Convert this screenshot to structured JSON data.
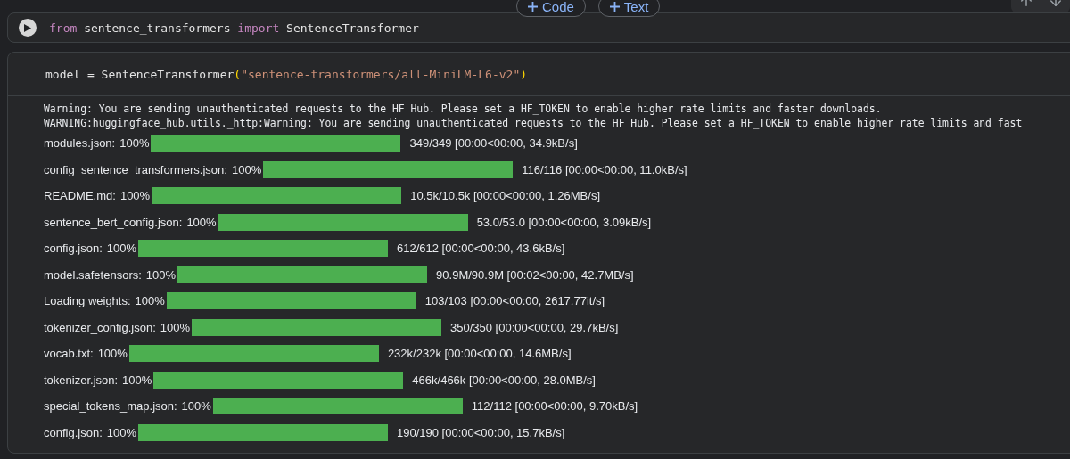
{
  "add_buttons": [
    {
      "label": "Code"
    },
    {
      "label": "Text"
    }
  ],
  "cells": [
    {
      "show_run_button": true,
      "code_lines": [
        [
          {
            "kind": "keyword",
            "text": "from"
          },
          {
            "kind": "plain",
            "text": " sentence_transformers "
          },
          {
            "kind": "keyword",
            "text": "import"
          },
          {
            "kind": "plain",
            "text": " SentenceTransformer"
          }
        ]
      ]
    },
    {
      "show_run_button": false,
      "code_lines": [
        [
          {
            "kind": "plain",
            "text": "model = SentenceTransformer"
          },
          {
            "kind": "bracket",
            "text": "("
          },
          {
            "kind": "string",
            "text": "\"sentence-transformers/all-MiniLM-L6-v2\""
          },
          {
            "kind": "bracket",
            "text": ")"
          }
        ]
      ],
      "output_text": [
        "Warning: You are sending unauthenticated requests to the HF Hub. Please set a HF_TOKEN to enable higher rate limits and faster downloads.",
        "WARNING:huggingface_hub.utils._http:Warning: You are sending unauthenticated requests to the HF Hub. Please set a HF_TOKEN to enable higher rate limits and fast"
      ],
      "progress": [
        {
          "label": "modules.json:",
          "percent": "100%",
          "level": 1,
          "stats": "349/349 [00:00<00:00, 34.9kB/s]"
        },
        {
          "label": "config_sentence_transformers.json:",
          "percent": "100%",
          "level": 1,
          "stats": "116/116 [00:00<00:00, 11.0kB/s]"
        },
        {
          "label": "README.md:",
          "percent": "100%",
          "level": 1,
          "stats": "10.5k/10.5k [00:00<00:00, 1.26MB/s]"
        },
        {
          "label": "sentence_bert_config.json:",
          "percent": "100%",
          "level": 1,
          "stats": "53.0/53.0 [00:00<00:00, 3.09kB/s]"
        },
        {
          "label": "config.json:",
          "percent": "100%",
          "level": 1,
          "stats": "612/612 [00:00<00:00, 43.6kB/s]"
        },
        {
          "label": "model.safetensors:",
          "percent": "100%",
          "level": 1,
          "stats": "90.9M/90.9M [00:02<00:00, 42.7MB/s]"
        },
        {
          "label": "Loading weights:",
          "percent": "100%",
          "level": 1,
          "stats": "103/103 [00:00<00:00, 2617.77it/s]"
        },
        {
          "label": "tokenizer_config.json:",
          "percent": "100%",
          "level": 1,
          "stats": "350/350 [00:00<00:00, 29.7kB/s]"
        },
        {
          "label": "vocab.txt:",
          "percent": "100%",
          "level": 1,
          "stats": "232k/232k [00:00<00:00, 14.6MB/s]"
        },
        {
          "label": "tokenizer.json:",
          "percent": "100%",
          "level": 1,
          "stats": "466k/466k [00:00<00:00, 28.0MB/s]"
        },
        {
          "label": "special_tokens_map.json:",
          "percent": "100%",
          "level": 1,
          "stats": "112/112 [00:00<00:00, 9.70kB/s]"
        },
        {
          "label": "config.json:",
          "percent": "100%",
          "level": 1,
          "stats": "190/190 [00:00<00:00, 15.7kB/s]"
        }
      ]
    }
  ]
}
